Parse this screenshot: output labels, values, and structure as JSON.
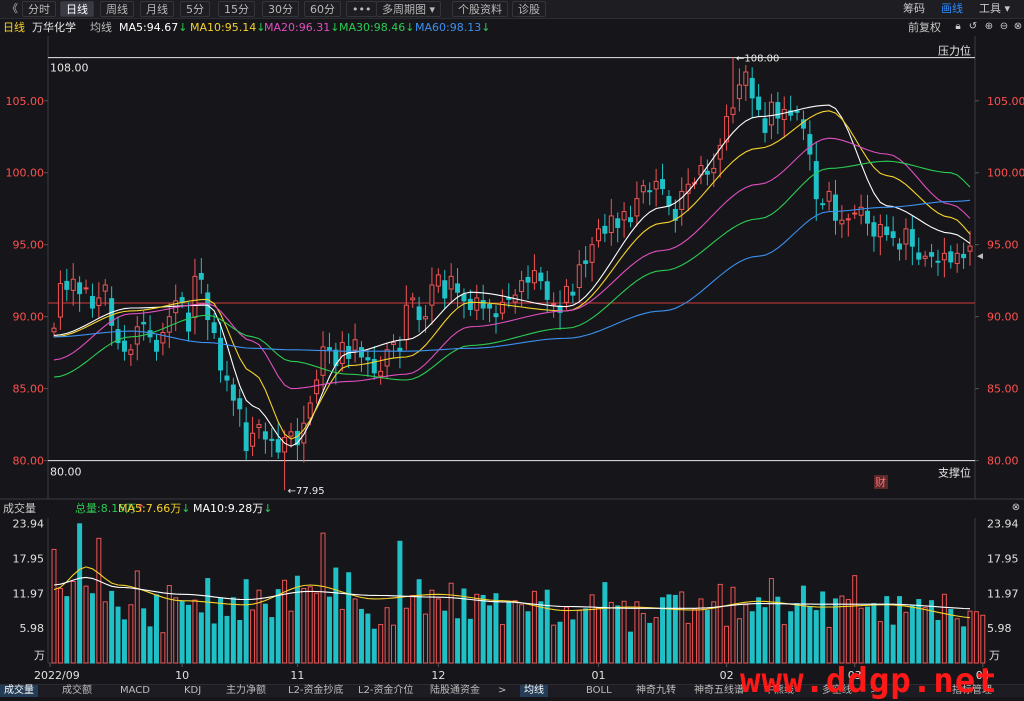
{
  "toolbar": {
    "back_glyph": "《",
    "buttons": [
      "分时",
      "日线",
      "周线",
      "月线",
      "5分",
      "15分",
      "30分",
      "60分",
      "•••",
      "多周期图 ▾",
      "个股资料",
      "诊股"
    ],
    "active_index": 1,
    "right": [
      "筹码",
      "画线",
      "工具 ▾"
    ],
    "right_active_index": 1
  },
  "info": {
    "period": "日线",
    "stock_name": "万华化学",
    "ma_label": "均线",
    "ma5": "MA5:94.67",
    "ma10": "MA10:95.14",
    "ma20": "MA20:96.31",
    "ma30": "MA30:98.46",
    "ma60": "MA60:98.13",
    "arrow_down": "↓",
    "fuquan": "前复权",
    "icons": [
      "lock-icon",
      "undo-icon",
      "zoom-in-icon",
      "zoom-out-icon",
      "close-icon"
    ]
  },
  "annotations": {
    "resistance_label": "压力位",
    "resistance_value": "108.00",
    "support_label": "支撑位",
    "support_value": "80.00",
    "high_label": "←108.00",
    "low_label": "←77.95",
    "cai_badge": "财"
  },
  "volume_info": {
    "title": "成交量",
    "total": "总量:8.15万",
    "ma5": "MA5:7.66万",
    "ma10": "MA10:9.28万",
    "unit": "万"
  },
  "bottom_tabs": [
    "成交量",
    "成交额",
    "MACD",
    "KDJ",
    "主力净额",
    "L2-资金抄底",
    "L2-资金介位",
    "陆股通资金",
    ">",
    "均线",
    "BOLL",
    "神奇九转",
    "神奇五线谱",
    "牛熊线",
    "多空线",
    ">",
    "指标管理"
  ],
  "bottom_active": [
    0,
    9
  ],
  "watermark": "www.ddgp.net",
  "colors": {
    "up": "#f05454",
    "down": "#1fc1c6",
    "ma5": "#ffffff",
    "ma10": "#f5d22b",
    "ma20": "#e04ec0",
    "ma30": "#2bcb52",
    "ma60": "#3b90f0",
    "hline": "#d03a3a",
    "axis_text": "#ff5050"
  },
  "chart_data": [
    {
      "type": "candlestick",
      "title": "万华化学 日线",
      "y_ticks": [
        80,
        85,
        90,
        95,
        100,
        105
      ],
      "y_tick_labels": [
        "80.00",
        "85.00",
        "90.00",
        "95.00",
        "100.00",
        "105.00"
      ],
      "ylim": [
        79,
        109.5
      ],
      "x_tick_labels": [
        "2022/09",
        "10",
        "11",
        "12",
        "01",
        "02",
        "03",
        "04"
      ],
      "x_tick_index": [
        0,
        20,
        38,
        60,
        85,
        105,
        125,
        145
      ],
      "horizontal_lines": [
        108.0,
        90.95,
        80.0
      ],
      "start_close": 89.2,
      "closes": [
        89.2,
        92.3,
        91.9,
        92.6,
        91.6,
        92.0,
        90.6,
        91.3,
        92.2,
        89.4,
        88.2,
        87.6,
        87.7,
        89.3,
        89.5,
        88.6,
        87.6,
        88.9,
        90.0,
        91.1,
        91.0,
        89.0,
        92.8,
        92.6,
        89.8,
        88.9,
        86.3,
        85.6,
        84.2,
        83.6,
        80.7,
        81.9,
        82.5,
        81.5,
        81.4,
        80.6,
        81.6,
        82.0,
        81.1,
        82.6,
        84.0,
        85.6,
        87.9,
        87.7,
        86.6,
        88.2,
        87.1,
        88.4,
        87.2,
        87.0,
        86.1,
        86.2,
        87.7,
        88.2,
        87.6,
        90.8,
        91.3,
        89.8,
        90.0,
        92.2,
        92.9,
        91.3,
        92.8,
        91.7,
        91.1,
        90.5,
        91.3,
        90.6,
        90.6,
        90.0,
        91.0,
        91.2,
        91.5,
        92.5,
        92.4,
        93.2,
        92.5,
        91.2,
        90.9,
        90.3,
        92.1,
        91.5,
        93.6,
        93.7,
        95.0,
        96.1,
        95.8,
        97.0,
        96.2,
        97.3,
        96.6,
        98.2,
        99.1,
        98.7,
        99.4,
        98.9,
        97.7,
        96.7,
        98.7,
        99.2,
        99.3,
        100.5,
        99.9,
        100.3,
        101.9,
        103.9,
        104.5,
        106.1,
        107.0,
        105.2,
        104.4,
        102.8,
        104.9,
        103.8,
        104.4,
        104.0,
        104.2,
        103.1,
        101.3,
        98.2,
        97.8,
        98.7,
        96.7,
        96.7,
        96.8,
        97.2,
        97.6,
        96.5,
        95.6,
        96.4,
        95.7,
        95.5,
        94.7,
        96.1,
        94.9,
        94.0,
        94.2,
        94.2,
        93.8,
        94.4,
        93.8,
        94.4,
        94.1,
        94.9
      ],
      "ma_series": [
        {
          "name": "MA5",
          "anchors": [
            [
              0,
              88.7
            ],
            [
              12,
              90.6
            ],
            [
              24,
              90.8
            ],
            [
              31,
              83.8
            ],
            [
              37,
              81.0
            ],
            [
              46,
              87.5
            ],
            [
              55,
              88.4
            ],
            [
              65,
              91.7
            ],
            [
              80,
              90.7
            ],
            [
              95,
              97.6
            ],
            [
              110,
              103.9
            ],
            [
              121,
              104.7
            ],
            [
              130,
              97.7
            ],
            [
              140,
              95.8
            ],
            [
              145,
              94.7
            ]
          ]
        },
        {
          "name": "MA10",
          "anchors": [
            [
              0,
              88.6
            ],
            [
              12,
              90.4
            ],
            [
              24,
              91.2
            ],
            [
              31,
              86.1
            ],
            [
              37,
              81.5
            ],
            [
              46,
              86.6
            ],
            [
              55,
              87.2
            ],
            [
              65,
              91.0
            ],
            [
              80,
              90.4
            ],
            [
              95,
              96.5
            ],
            [
              110,
              101.7
            ],
            [
              121,
              104.3
            ],
            [
              130,
              99.8
            ],
            [
              140,
              96.9
            ],
            [
              145,
              95.1
            ]
          ]
        },
        {
          "name": "MA20",
          "anchors": [
            [
              0,
              87.0
            ],
            [
              12,
              90.2
            ],
            [
              24,
              90.9
            ],
            [
              31,
              88.3
            ],
            [
              37,
              85.0
            ],
            [
              46,
              85.5
            ],
            [
              55,
              86.0
            ],
            [
              65,
              89.3
            ],
            [
              80,
              90.4
            ],
            [
              95,
              94.6
            ],
            [
              110,
              99.2
            ],
            [
              121,
              102.4
            ],
            [
              130,
              101.3
            ],
            [
              140,
              97.8
            ],
            [
              145,
              96.3
            ]
          ]
        },
        {
          "name": "MA30",
          "anchors": [
            [
              0,
              85.8
            ],
            [
              12,
              88.6
            ],
            [
              24,
              90.1
            ],
            [
              31,
              88.6
            ],
            [
              37,
              86.9
            ],
            [
              46,
              86.0
            ],
            [
              55,
              85.6
            ],
            [
              65,
              88.0
            ],
            [
              80,
              89.2
            ],
            [
              95,
              93.2
            ],
            [
              110,
              96.8
            ],
            [
              121,
              100.3
            ],
            [
              130,
              100.8
            ],
            [
              140,
              100.0
            ],
            [
              145,
              98.46
            ]
          ]
        },
        {
          "name": "MA60",
          "anchors": [
            [
              0,
              88.6
            ],
            [
              12,
              89.0
            ],
            [
              24,
              88.2
            ],
            [
              31,
              87.8
            ],
            [
              37,
              87.7
            ],
            [
              46,
              87.6
            ],
            [
              55,
              87.6
            ],
            [
              65,
              87.8
            ],
            [
              80,
              88.5
            ],
            [
              95,
              90.4
            ],
            [
              110,
              94.2
            ],
            [
              121,
              97.3
            ],
            [
              130,
              97.6
            ],
            [
              140,
              98.0
            ],
            [
              145,
              98.13
            ]
          ]
        }
      ]
    },
    {
      "type": "bar",
      "title": "成交量",
      "unit": "万",
      "y_ticks": [
        5.98,
        11.97,
        17.95,
        23.94
      ],
      "y_tick_labels": [
        "5.98",
        "11.97",
        "17.95",
        "23.94"
      ],
      "ylim": [
        0,
        24.9
      ],
      "volume": [
        19.5,
        12.8,
        11.4,
        14.0,
        23.9,
        13.2,
        11.9,
        21.4,
        10.5,
        12.3,
        9.6,
        7.4,
        10.0,
        15.8,
        9.3,
        6.2,
        11.7,
        5.2,
        13.3,
        11.2,
        10.6,
        9.9,
        10.8,
        8.6,
        14.5,
        6.7,
        11.1,
        8.0,
        11.2,
        7.3,
        14.3,
        9.1,
        12.5,
        10.1,
        7.8,
        12.6,
        14.2,
        8.9,
        14.9,
        12.8,
        13.1,
        12.0,
        22.3,
        11.3,
        16.3,
        9.2,
        15.5,
        11.0,
        9.2,
        8.4,
        5.8,
        6.6,
        9.5,
        6.5,
        20.9,
        9.4,
        11.6,
        14.3,
        8.4,
        12.5,
        11.0,
        8.9,
        13.7,
        7.6,
        12.7,
        7.5,
        11.8,
        11.6,
        9.8,
        11.9,
        6.6,
        10.4,
        10.7,
        10.0,
        8.8,
        12.3,
        10.5,
        12.5,
        6.5,
        7.0,
        9.6,
        7.4,
        9.0,
        9.3,
        11.7,
        9.5,
        13.8,
        10.4,
        9.8,
        10.6,
        5.3,
        10.5,
        8.5,
        6.8,
        7.8,
        11.2,
        11.7,
        11.6,
        12.2,
        6.8,
        9.3,
        11.0,
        9.0,
        10.5,
        13.5,
        6.3,
        13.0,
        7.6,
        10.0,
        8.8,
        11.2,
        9.5,
        14.5,
        11.3,
        6.6,
        8.8,
        10.2,
        13.2,
        9.7,
        9.0,
        12.2,
        6.1,
        11.0,
        11.5,
        10.9,
        15.0,
        9.4,
        9.6,
        10.2,
        7.1,
        11.4,
        6.5,
        11.4,
        8.7,
        9.9,
        10.9,
        9.5,
        10.7,
        7.3,
        11.8,
        9.2,
        7.6,
        6.2,
        8.9,
        8.8,
        8.2
      ],
      "ma_series": [
        {
          "name": "MA5",
          "anchors": [
            [
              0,
              12.6
            ],
            [
              5,
              16.5
            ],
            [
              10,
              13.4
            ],
            [
              20,
              10.7
            ],
            [
              30,
              10.0
            ],
            [
              40,
              13.4
            ],
            [
              50,
              11.0
            ],
            [
              60,
              11.8
            ],
            [
              70,
              10.7
            ],
            [
              80,
              9.0
            ],
            [
              90,
              9.6
            ],
            [
              100,
              9.1
            ],
            [
              110,
              10.6
            ],
            [
              120,
              9.6
            ],
            [
              130,
              10.0
            ],
            [
              145,
              7.66
            ]
          ]
        },
        {
          "name": "MA10",
          "anchors": [
            [
              0,
              13.4
            ],
            [
              5,
              14.7
            ],
            [
              10,
              13.0
            ],
            [
              20,
              11.8
            ],
            [
              30,
              10.9
            ],
            [
              40,
              12.3
            ],
            [
              50,
              11.6
            ],
            [
              60,
              11.3
            ],
            [
              70,
              10.5
            ],
            [
              80,
              9.7
            ],
            [
              90,
              9.4
            ],
            [
              100,
              9.4
            ],
            [
              110,
              10.2
            ],
            [
              120,
              10.1
            ],
            [
              130,
              10.1
            ],
            [
              145,
              9.28
            ]
          ]
        }
      ]
    }
  ]
}
